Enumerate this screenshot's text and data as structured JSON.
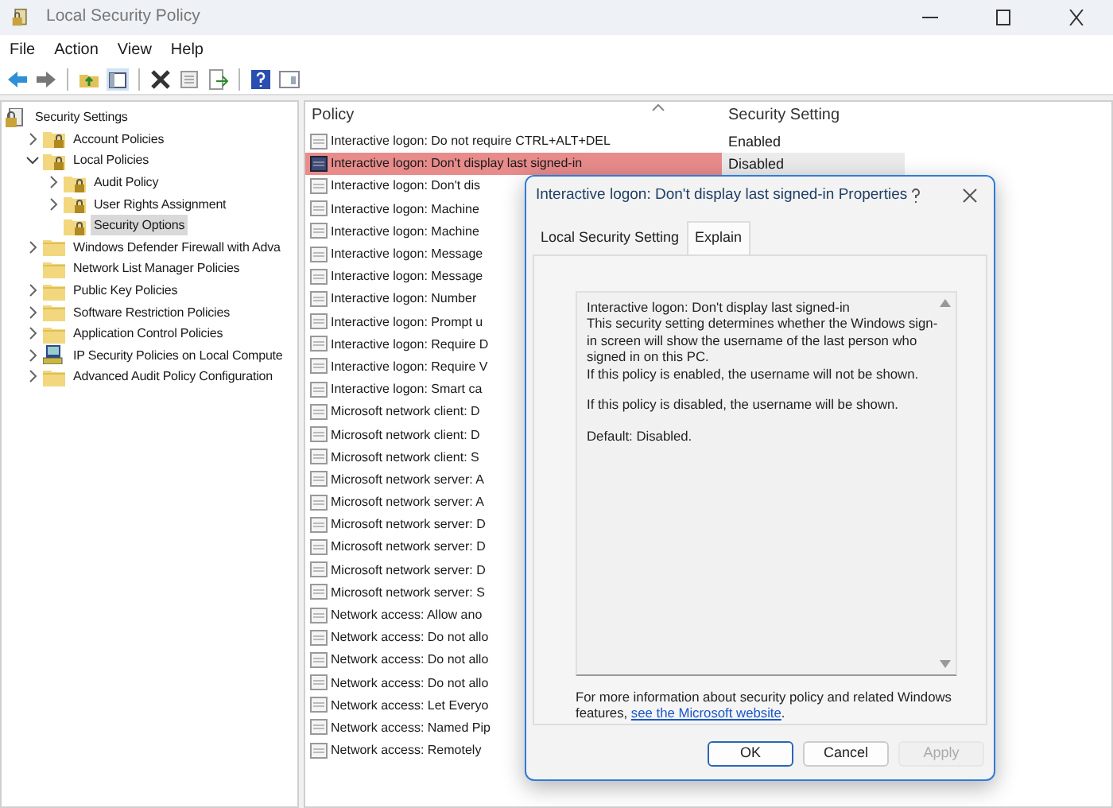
{
  "window": {
    "title": "Local Security Policy"
  },
  "menu": [
    "File",
    "Action",
    "View",
    "Help"
  ],
  "tree": [
    {
      "label": "Security Settings",
      "kind": "root",
      "selected": false,
      "children": [
        {
          "label": "Account Policies",
          "kind": "policy-folder",
          "expanded": false,
          "selected": false
        },
        {
          "label": "Local Policies",
          "kind": "policy-folder",
          "expanded": true,
          "selected": false,
          "children": [
            {
              "label": "Audit Policy",
              "kind": "policy-folder",
              "expanded": false,
              "selected": false
            },
            {
              "label": "User Rights Assignment",
              "kind": "policy-folder",
              "expanded": false,
              "selected": false
            },
            {
              "label": "Security Options",
              "kind": "policy-folder",
              "selected": true
            }
          ]
        },
        {
          "label": "Windows Defender Firewall with Adva",
          "kind": "folder",
          "expanded": false,
          "selected": false
        },
        {
          "label": "Network List Manager Policies",
          "kind": "folder",
          "selected": false
        },
        {
          "label": "Public Key Policies",
          "kind": "folder",
          "expanded": false,
          "selected": false
        },
        {
          "label": "Software Restriction Policies",
          "kind": "folder",
          "expanded": false,
          "selected": false
        },
        {
          "label": "Application Control Policies",
          "kind": "folder",
          "expanded": false,
          "selected": false
        },
        {
          "label": "IP Security Policies on Local Compute",
          "kind": "computer",
          "expanded": false,
          "selected": false
        },
        {
          "label": "Advanced Audit Policy Configuration",
          "kind": "folder",
          "expanded": false,
          "selected": false
        }
      ]
    }
  ],
  "table": {
    "columns": [
      "Policy",
      "Security Setting"
    ],
    "rows": [
      {
        "policy": "Interactive logon: Do not require CTRL+ALT+DEL",
        "setting": "Enabled",
        "selected": false
      },
      {
        "policy": "Interactive logon: Don't display last signed-in",
        "setting": "Disabled",
        "selected": true
      },
      {
        "policy": "Interactive logon: Don't dis",
        "selected": false
      },
      {
        "policy": "Interactive logon: Machine",
        "selected": false
      },
      {
        "policy": "Interactive logon: Machine",
        "selected": false
      },
      {
        "policy": "Interactive logon: Message",
        "selected": false
      },
      {
        "policy": "Interactive logon: Message",
        "selected": false
      },
      {
        "policy": "Interactive logon: Number",
        "selected": false
      },
      {
        "policy": "Interactive logon: Prompt u",
        "selected": false
      },
      {
        "policy": "Interactive logon: Require D",
        "selected": false
      },
      {
        "policy": "Interactive logon: Require V",
        "selected": false
      },
      {
        "policy": "Interactive logon: Smart ca",
        "selected": false
      },
      {
        "policy": "Microsoft network client: D",
        "selected": false
      },
      {
        "policy": "Microsoft network client: D",
        "selected": false
      },
      {
        "policy": "Microsoft network client: S",
        "selected": false
      },
      {
        "policy": "Microsoft network server: A",
        "selected": false
      },
      {
        "policy": "Microsoft network server: A",
        "selected": false
      },
      {
        "policy": "Microsoft network server: D",
        "selected": false
      },
      {
        "policy": "Microsoft network server: D",
        "selected": false
      },
      {
        "policy": "Microsoft network server: D",
        "selected": false
      },
      {
        "policy": "Microsoft network server: S",
        "selected": false
      },
      {
        "policy": "Network access: Allow ano",
        "selected": false
      },
      {
        "policy": "Network access: Do not allo",
        "selected": false
      },
      {
        "policy": "Network access: Do not allo",
        "selected": false
      },
      {
        "policy": "Network access: Do not allo",
        "selected": false
      },
      {
        "policy": "Network access: Let Everyo",
        "selected": false
      },
      {
        "policy": "Network access: Named Pip",
        "selected": false
      },
      {
        "policy": "Network access: Remotely",
        "selected": false
      }
    ]
  },
  "dialog": {
    "title": "Interactive logon: Don't display last signed-in Properties",
    "tabs": [
      {
        "label": "Local Security Setting",
        "selected": false
      },
      {
        "label": "Explain",
        "selected": true
      }
    ],
    "explain": [
      "Interactive logon: Don't display last signed-in\nThis security setting determines whether the Windows sign-in screen will show the username of the last person who signed in on this PC.\nIf this policy is enabled, the username will not be shown.",
      "If this policy is disabled, the username will be shown.",
      "Default: Disabled."
    ],
    "footer": {
      "text": "For more information about security policy and related Windows features, ",
      "link": "see the Microsoft website",
      "after": "."
    },
    "buttons": [
      {
        "label": "OK",
        "default": true,
        "disabled": false
      },
      {
        "label": "Cancel",
        "default": false,
        "disabled": false
      },
      {
        "label": "Apply",
        "default": false,
        "disabled": true
      }
    ]
  }
}
